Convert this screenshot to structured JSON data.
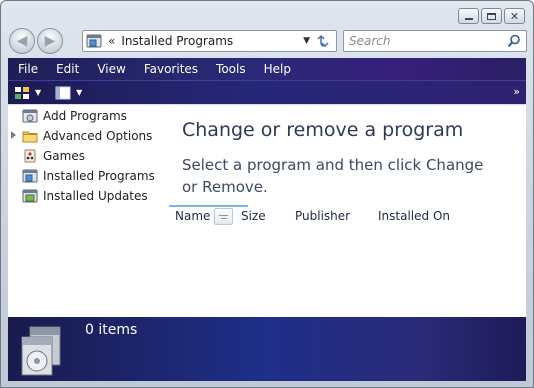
{
  "window": {
    "caption": {
      "minimize": "",
      "maximize": "",
      "close": "✕"
    }
  },
  "nav": {
    "back_glyph": "◀",
    "forward_glyph": "▶",
    "address": {
      "separator": "«",
      "location": "Installed Programs",
      "icon": "installed-programs-icon"
    },
    "search": {
      "placeholder": "Search"
    }
  },
  "menu": {
    "items": [
      "File",
      "Edit",
      "View",
      "Favorites",
      "Tools",
      "Help"
    ]
  },
  "toolbar": {
    "overflow": "»"
  },
  "sidebar": {
    "items": [
      {
        "label": "Add Programs",
        "icon": "add-programs-icon"
      },
      {
        "label": "Advanced Options",
        "icon": "folder-icon"
      },
      {
        "label": "Games",
        "icon": "games-icon"
      },
      {
        "label": "Installed Programs",
        "icon": "installed-programs-icon"
      },
      {
        "label": "Installed Updates",
        "icon": "installed-updates-icon"
      }
    ]
  },
  "main": {
    "title": "Change or remove a program",
    "description": "Select a program and then click Change or Remove.",
    "columns": [
      "Name",
      "Size",
      "Publisher",
      "Installed On"
    ]
  },
  "details": {
    "count": "0 items",
    "icon": "programs-box-icon"
  },
  "colors": {
    "menu_bar": "#292a78",
    "details_pane": "#1f2f8a",
    "title_text": "#2c3a55",
    "column_highlight": "#7fb6e0"
  }
}
